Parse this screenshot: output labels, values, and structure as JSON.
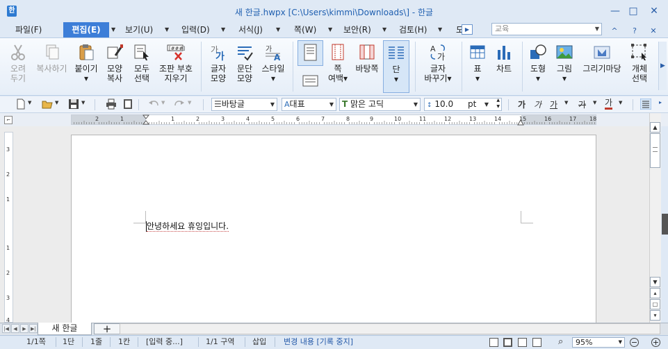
{
  "window": {
    "app_icon": "한",
    "title": "새 한글.hwpx [C:\\Users\\kimmi\\Downloads\\] - 한글",
    "minimize": "—",
    "maximize": "□",
    "close": "✕"
  },
  "menu": {
    "items": [
      {
        "label": "파일(F)",
        "active": false
      },
      {
        "label": "편집(E)",
        "active": true
      },
      {
        "label": "보기(U)",
        "active": false
      },
      {
        "label": "입력(D)",
        "active": false
      },
      {
        "label": "서식(J)",
        "active": false
      },
      {
        "label": "쪽(W)",
        "active": false
      },
      {
        "label": "보안(R)",
        "active": false
      },
      {
        "label": "검토(H)",
        "active": false
      },
      {
        "label": "도",
        "active": false
      }
    ],
    "arrow": "▼",
    "overflow": "▶",
    "style_combo_value": "교육",
    "collapse_ribbon": "^",
    "help": "?",
    "close_doc": "✕"
  },
  "ribbon": {
    "buttons": [
      {
        "id": "undo-cut",
        "label": "오려\n두기",
        "icon": "scissors-icon",
        "disabled": true
      },
      {
        "id": "copy",
        "label": "복사하기",
        "icon": "copy-icon",
        "disabled": true
      },
      {
        "id": "paste",
        "label": "붙이기\n▾",
        "icon": "clipboard-icon",
        "disabled": false
      },
      {
        "id": "format-copy",
        "label": "모양\n복사",
        "icon": "format-painter-icon",
        "disabled": false
      },
      {
        "id": "select-all",
        "label": "모두\n선택",
        "icon": "select-all-icon",
        "disabled": false
      },
      {
        "id": "clear-marks",
        "label": "조판 부호\n지우기",
        "icon": "clear-marks-icon",
        "disabled": false
      },
      {
        "id": "char-shape",
        "label": "글자\n모양",
        "icon": "char-shape-icon",
        "disabled": false
      },
      {
        "id": "para-shape",
        "label": "문단\n모양",
        "icon": "para-shape-icon",
        "disabled": false
      },
      {
        "id": "style",
        "label": "스타일\n▾",
        "icon": "style-icon",
        "disabled": false
      },
      {
        "id": "page-margin",
        "label": "쪽\n여백▾",
        "icon": "page-margin-icon",
        "disabled": false
      },
      {
        "id": "background-page",
        "label": "바탕쪽",
        "icon": "background-page-icon",
        "disabled": false
      },
      {
        "id": "columns",
        "label": "단\n▾",
        "icon": "columns-icon",
        "disabled": false
      },
      {
        "id": "char-replace",
        "label": "글자\n바꾸기▾",
        "icon": "char-replace-icon",
        "disabled": false
      },
      {
        "id": "table",
        "label": "표\n▾",
        "icon": "table-icon",
        "disabled": false
      },
      {
        "id": "chart",
        "label": "차트",
        "icon": "chart-icon",
        "disabled": false
      },
      {
        "id": "shape",
        "label": "도형\n▾",
        "icon": "shape-icon",
        "disabled": false
      },
      {
        "id": "picture",
        "label": "그림\n▾",
        "icon": "picture-icon",
        "disabled": false
      },
      {
        "id": "clipart",
        "label": "그리기마당",
        "icon": "clipart-icon",
        "disabled": false
      },
      {
        "id": "object-select",
        "label": "개체\n선택",
        "icon": "object-select-icon",
        "disabled": false
      }
    ],
    "pin": "▶"
  },
  "format_toolbar": {
    "style_name": "바탕글",
    "language": "대표",
    "font_name": "맑은 고딕",
    "font_size": "10.0",
    "font_unit": "pt",
    "bold": "가",
    "italic": "가",
    "underline": "가",
    "strike": "가",
    "color": "가",
    "dropdown": "▼",
    "spin_up": "▲",
    "spin_down": "▼"
  },
  "ruler": {
    "labels": [
      "2",
      "1",
      "1",
      "2",
      "3",
      "4",
      "5",
      "6",
      "7",
      "8",
      "9",
      "10",
      "11",
      "12",
      "13",
      "14",
      "15",
      "16",
      "17",
      "18"
    ],
    "vertical_labels": [
      "3",
      "2",
      "1",
      "1",
      "2",
      "3",
      "4"
    ],
    "corner": "⌐"
  },
  "document": {
    "text": "안녕하세요 휴잉입니다."
  },
  "scrollbar": {
    "up": "▲",
    "down": "▼",
    "page_up": "▴",
    "page_btn": "□",
    "page_down": "▾"
  },
  "tabs": {
    "nav": [
      "|◀",
      "◀",
      "▶",
      "▶|"
    ],
    "doc_tab": "새 한글",
    "add": "+"
  },
  "status": {
    "page": "1/1쪽",
    "column": "1단",
    "line": "1줄",
    "col_pos": "1칸",
    "input_state": "[입력 중...]",
    "section": "1/1 구역",
    "insert_mode": "삽입",
    "track_changes": "변경 내용 [기록 중지]",
    "zoom_icon": "⌕",
    "zoom": "95%",
    "zoom_out": "−",
    "zoom_in": "+"
  }
}
